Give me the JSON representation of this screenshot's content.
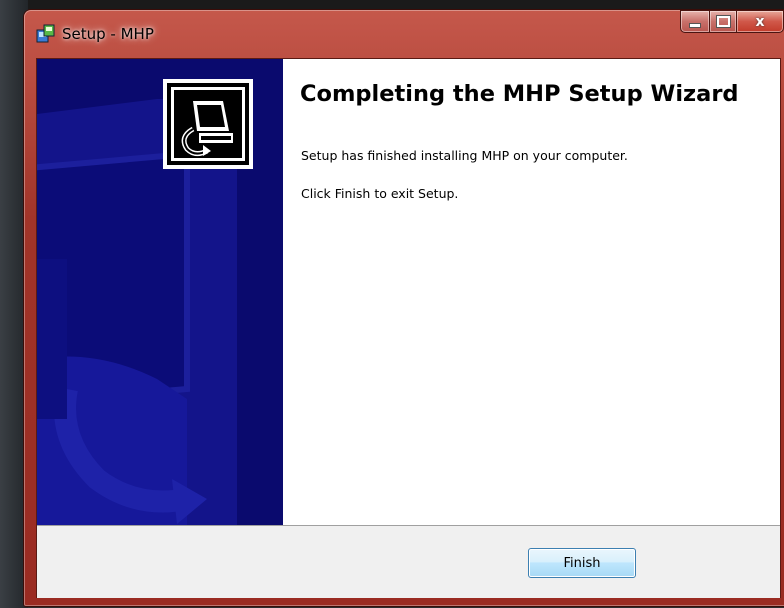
{
  "window": {
    "title": "Setup - MHP",
    "title_icon": "setup-installer-icon",
    "caption_buttons": [
      "minimize",
      "maximize",
      "close"
    ],
    "close_glyph": "x",
    "frame_color": "#a13429"
  },
  "banner": {
    "background_color": "#0a0a6e",
    "logo_icon": "computer-install-icon"
  },
  "content": {
    "heading": "Completing the MHP Setup Wizard",
    "message": "Setup has finished installing MHP on your computer.",
    "instruction": "Click Finish to exit Setup."
  },
  "footer": {
    "finish_label": "Finish"
  }
}
